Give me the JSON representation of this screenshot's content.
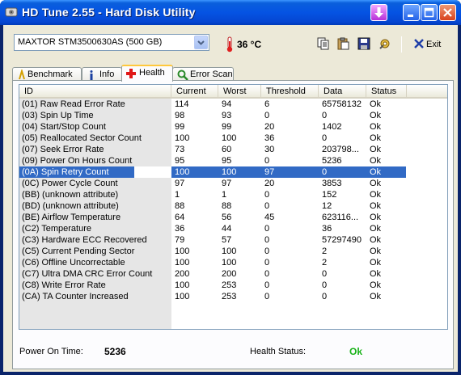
{
  "window": {
    "title": "HD Tune 2.55 - Hard Disk Utility"
  },
  "toolbar": {
    "drive": "MAXTOR STM3500630AS (500 GB)",
    "temperature": "36 °C",
    "exit_label": "Exit"
  },
  "tabs": [
    {
      "label": "Benchmark",
      "icon": "benchmark-icon",
      "active": false
    },
    {
      "label": "Info",
      "icon": "info-icon",
      "active": false
    },
    {
      "label": "Health",
      "icon": "health-icon",
      "active": true
    },
    {
      "label": "Error Scan",
      "icon": "error-scan-icon",
      "active": false
    }
  ],
  "columns": [
    "ID",
    "Current",
    "Worst",
    "Threshold",
    "Data",
    "Status"
  ],
  "rows": [
    {
      "id": "(01) Raw Read Error Rate",
      "current": "114",
      "worst": "94",
      "threshold": "6",
      "data": "65758132",
      "status": "Ok"
    },
    {
      "id": "(03) Spin Up Time",
      "current": "98",
      "worst": "93",
      "threshold": "0",
      "data": "0",
      "status": "Ok"
    },
    {
      "id": "(04) Start/Stop Count",
      "current": "99",
      "worst": "99",
      "threshold": "20",
      "data": "1402",
      "status": "Ok"
    },
    {
      "id": "(05) Reallocated Sector Count",
      "current": "100",
      "worst": "100",
      "threshold": "36",
      "data": "0",
      "status": "Ok"
    },
    {
      "id": "(07) Seek Error Rate",
      "current": "73",
      "worst": "60",
      "threshold": "30",
      "data": "203798...",
      "status": "Ok"
    },
    {
      "id": "(09) Power On Hours Count",
      "current": "95",
      "worst": "95",
      "threshold": "0",
      "data": "5236",
      "status": "Ok"
    },
    {
      "id": "(0A) Spin Retry Count",
      "current": "100",
      "worst": "100",
      "threshold": "97",
      "data": "0",
      "status": "Ok",
      "selected": true
    },
    {
      "id": "(0C) Power Cycle Count",
      "current": "97",
      "worst": "97",
      "threshold": "20",
      "data": "3853",
      "status": "Ok"
    },
    {
      "id": "(BB) (unknown attribute)",
      "current": "1",
      "worst": "1",
      "threshold": "0",
      "data": "152",
      "status": "Ok"
    },
    {
      "id": "(BD) (unknown attribute)",
      "current": "88",
      "worst": "88",
      "threshold": "0",
      "data": "12",
      "status": "Ok"
    },
    {
      "id": "(BE) Airflow Temperature",
      "current": "64",
      "worst": "56",
      "threshold": "45",
      "data": "623116...",
      "status": "Ok"
    },
    {
      "id": "(C2) Temperature",
      "current": "36",
      "worst": "44",
      "threshold": "0",
      "data": "36",
      "status": "Ok"
    },
    {
      "id": "(C3) Hardware ECC Recovered",
      "current": "79",
      "worst": "57",
      "threshold": "0",
      "data": "57297490",
      "status": "Ok"
    },
    {
      "id": "(C5) Current Pending Sector",
      "current": "100",
      "worst": "100",
      "threshold": "0",
      "data": "2",
      "status": "Ok"
    },
    {
      "id": "(C6) Offline Uncorrectable",
      "current": "100",
      "worst": "100",
      "threshold": "0",
      "data": "2",
      "status": "Ok"
    },
    {
      "id": "(C7) Ultra DMA CRC Error Count",
      "current": "200",
      "worst": "200",
      "threshold": "0",
      "data": "0",
      "status": "Ok"
    },
    {
      "id": "(C8) Write Error Rate",
      "current": "100",
      "worst": "253",
      "threshold": "0",
      "data": "0",
      "status": "Ok"
    },
    {
      "id": "(CA) TA Counter Increased",
      "current": "100",
      "worst": "253",
      "threshold": "0",
      "data": "0",
      "status": "Ok"
    }
  ],
  "footer": {
    "power_on_label": "Power On Time:",
    "power_on_value": "5236",
    "health_label": "Health Status:",
    "health_value": "Ok"
  },
  "colors": {
    "selection": "#316ac5",
    "ok_green": "#17b217",
    "titlebar": "#0553e3"
  }
}
